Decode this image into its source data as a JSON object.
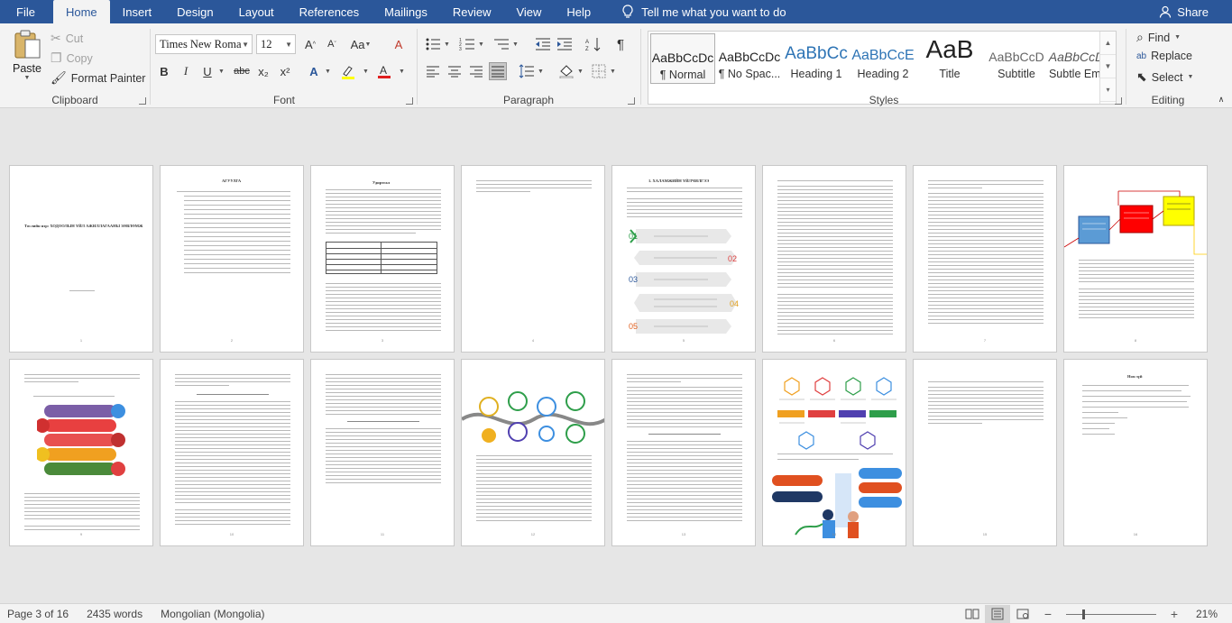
{
  "tabs": [
    "File",
    "Home",
    "Insert",
    "Design",
    "Layout",
    "References",
    "Mailings",
    "Review",
    "View",
    "Help"
  ],
  "active_tab": "Home",
  "tell_me": "Tell me what you want to do",
  "share": "Share",
  "clipboard": {
    "paste": "Paste",
    "cut": "Cut",
    "copy": "Copy",
    "format_painter": "Format Painter",
    "label": "Clipboard"
  },
  "font": {
    "name": "Times New Roma",
    "size": "12",
    "label": "Font",
    "bold": "B",
    "italic": "I",
    "underline": "U",
    "strike": "abc",
    "sub": "x₂",
    "sup": "x²"
  },
  "paragraph": {
    "label": "Paragraph"
  },
  "styles": {
    "label": "Styles",
    "items": [
      {
        "sample": "AaBbCcDc",
        "name": "¶ Normal"
      },
      {
        "sample": "AaBbCcDc",
        "name": "¶ No Spac..."
      },
      {
        "sample": "AaBbCc",
        "name": "Heading 1"
      },
      {
        "sample": "AaBbCcE",
        "name": "Heading 2"
      },
      {
        "sample": "AaB",
        "name": "Title"
      },
      {
        "sample": "AaBbCcD",
        "name": "Subtitle"
      },
      {
        "sample": "AaBbCcDc",
        "name": "Subtle Em..."
      }
    ]
  },
  "editing": {
    "find": "Find",
    "replace": "Replace",
    "select": "Select",
    "label": "Editing"
  },
  "pages": {
    "p1_title": "Төслийн нэр: ХОДООЛЫН ҮЙЛ АЖИЛЛАГААНЫ ЗӨВЛӨМЖ",
    "p2_title": "АГУУЛГА",
    "p3_title": "Удиртгал",
    "p5_title": "1. ХАЛАМЖИЙН ҮЙЛЧИЛГЭЭ",
    "p16_title": "Ном зүй"
  },
  "status": {
    "page": "Page 3 of 16",
    "words": "2435 words",
    "language": "Mongolian (Mongolia)",
    "zoom": "21%"
  }
}
